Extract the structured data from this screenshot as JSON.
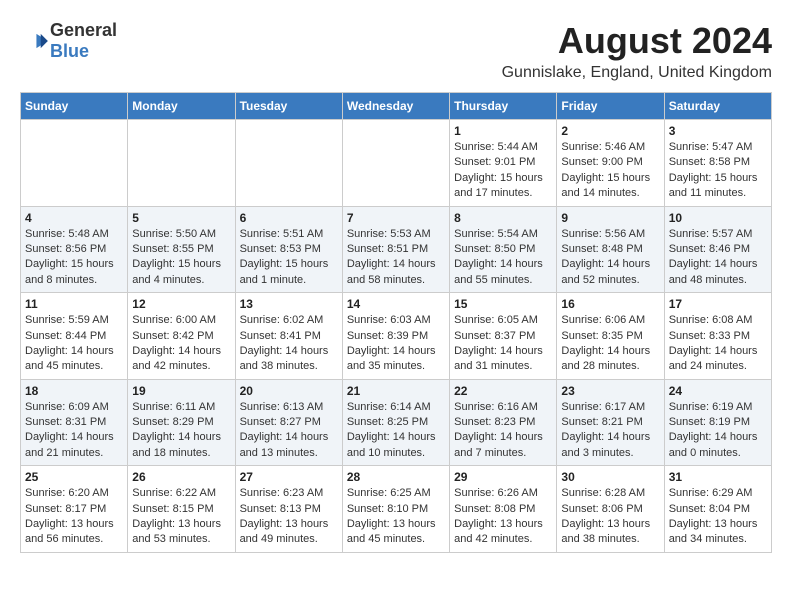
{
  "header": {
    "logo_general": "General",
    "logo_blue": "Blue",
    "month_year": "August 2024",
    "location": "Gunnislake, England, United Kingdom"
  },
  "weekdays": [
    "Sunday",
    "Monday",
    "Tuesday",
    "Wednesday",
    "Thursday",
    "Friday",
    "Saturday"
  ],
  "weeks": [
    [
      {
        "day": "",
        "content": ""
      },
      {
        "day": "",
        "content": ""
      },
      {
        "day": "",
        "content": ""
      },
      {
        "day": "",
        "content": ""
      },
      {
        "day": "1",
        "content": "Sunrise: 5:44 AM\nSunset: 9:01 PM\nDaylight: 15 hours and 17 minutes."
      },
      {
        "day": "2",
        "content": "Sunrise: 5:46 AM\nSunset: 9:00 PM\nDaylight: 15 hours and 14 minutes."
      },
      {
        "day": "3",
        "content": "Sunrise: 5:47 AM\nSunset: 8:58 PM\nDaylight: 15 hours and 11 minutes."
      }
    ],
    [
      {
        "day": "4",
        "content": "Sunrise: 5:48 AM\nSunset: 8:56 PM\nDaylight: 15 hours and 8 minutes."
      },
      {
        "day": "5",
        "content": "Sunrise: 5:50 AM\nSunset: 8:55 PM\nDaylight: 15 hours and 4 minutes."
      },
      {
        "day": "6",
        "content": "Sunrise: 5:51 AM\nSunset: 8:53 PM\nDaylight: 15 hours and 1 minute."
      },
      {
        "day": "7",
        "content": "Sunrise: 5:53 AM\nSunset: 8:51 PM\nDaylight: 14 hours and 58 minutes."
      },
      {
        "day": "8",
        "content": "Sunrise: 5:54 AM\nSunset: 8:50 PM\nDaylight: 14 hours and 55 minutes."
      },
      {
        "day": "9",
        "content": "Sunrise: 5:56 AM\nSunset: 8:48 PM\nDaylight: 14 hours and 52 minutes."
      },
      {
        "day": "10",
        "content": "Sunrise: 5:57 AM\nSunset: 8:46 PM\nDaylight: 14 hours and 48 minutes."
      }
    ],
    [
      {
        "day": "11",
        "content": "Sunrise: 5:59 AM\nSunset: 8:44 PM\nDaylight: 14 hours and 45 minutes."
      },
      {
        "day": "12",
        "content": "Sunrise: 6:00 AM\nSunset: 8:42 PM\nDaylight: 14 hours and 42 minutes."
      },
      {
        "day": "13",
        "content": "Sunrise: 6:02 AM\nSunset: 8:41 PM\nDaylight: 14 hours and 38 minutes."
      },
      {
        "day": "14",
        "content": "Sunrise: 6:03 AM\nSunset: 8:39 PM\nDaylight: 14 hours and 35 minutes."
      },
      {
        "day": "15",
        "content": "Sunrise: 6:05 AM\nSunset: 8:37 PM\nDaylight: 14 hours and 31 minutes."
      },
      {
        "day": "16",
        "content": "Sunrise: 6:06 AM\nSunset: 8:35 PM\nDaylight: 14 hours and 28 minutes."
      },
      {
        "day": "17",
        "content": "Sunrise: 6:08 AM\nSunset: 8:33 PM\nDaylight: 14 hours and 24 minutes."
      }
    ],
    [
      {
        "day": "18",
        "content": "Sunrise: 6:09 AM\nSunset: 8:31 PM\nDaylight: 14 hours and 21 minutes."
      },
      {
        "day": "19",
        "content": "Sunrise: 6:11 AM\nSunset: 8:29 PM\nDaylight: 14 hours and 18 minutes."
      },
      {
        "day": "20",
        "content": "Sunrise: 6:13 AM\nSunset: 8:27 PM\nDaylight: 14 hours and 13 minutes."
      },
      {
        "day": "21",
        "content": "Sunrise: 6:14 AM\nSunset: 8:25 PM\nDaylight: 14 hours and 10 minutes."
      },
      {
        "day": "22",
        "content": "Sunrise: 6:16 AM\nSunset: 8:23 PM\nDaylight: 14 hours and 7 minutes."
      },
      {
        "day": "23",
        "content": "Sunrise: 6:17 AM\nSunset: 8:21 PM\nDaylight: 14 hours and 3 minutes."
      },
      {
        "day": "24",
        "content": "Sunrise: 6:19 AM\nSunset: 8:19 PM\nDaylight: 14 hours and 0 minutes."
      }
    ],
    [
      {
        "day": "25",
        "content": "Sunrise: 6:20 AM\nSunset: 8:17 PM\nDaylight: 13 hours and 56 minutes."
      },
      {
        "day": "26",
        "content": "Sunrise: 6:22 AM\nSunset: 8:15 PM\nDaylight: 13 hours and 53 minutes."
      },
      {
        "day": "27",
        "content": "Sunrise: 6:23 AM\nSunset: 8:13 PM\nDaylight: 13 hours and 49 minutes."
      },
      {
        "day": "28",
        "content": "Sunrise: 6:25 AM\nSunset: 8:10 PM\nDaylight: 13 hours and 45 minutes."
      },
      {
        "day": "29",
        "content": "Sunrise: 6:26 AM\nSunset: 8:08 PM\nDaylight: 13 hours and 42 minutes."
      },
      {
        "day": "30",
        "content": "Sunrise: 6:28 AM\nSunset: 8:06 PM\nDaylight: 13 hours and 38 minutes."
      },
      {
        "day": "31",
        "content": "Sunrise: 6:29 AM\nSunset: 8:04 PM\nDaylight: 13 hours and 34 minutes."
      }
    ]
  ]
}
